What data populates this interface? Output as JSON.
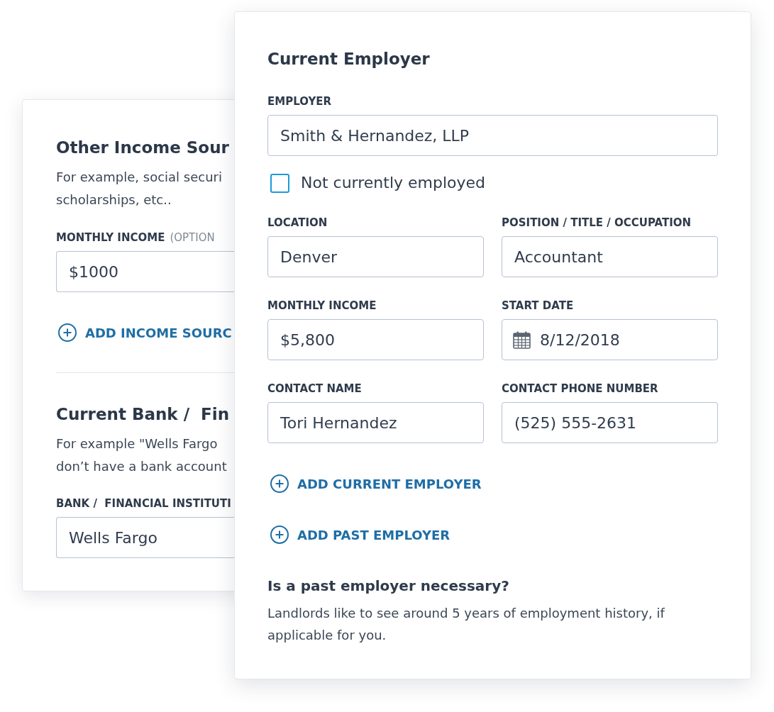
{
  "background_card": {
    "sections": [
      {
        "title": "Other Income Sour",
        "description_lines": [
          "For example, social securi",
          "scholarships, etc.."
        ],
        "field": {
          "label": "MONTHLY INCOME",
          "hint": "(OPTION",
          "value": "$1000"
        },
        "add_link": "ADD INCOME SOURC"
      },
      {
        "title": "Current Bank /  Fin",
        "description_lines": [
          "For example \"Wells Fargo",
          "don’t have a bank account"
        ],
        "field": {
          "label": "BANK /  FINANCIAL INSTITUTI",
          "value": "Wells Fargo"
        }
      }
    ]
  },
  "employer_card": {
    "title": "Current Employer",
    "employer_field": {
      "label": "EMPLOYER",
      "value": "Smith & Hernandez, LLP"
    },
    "not_employed_checkbox": {
      "label": "Not currently employed",
      "checked": false
    },
    "fields": [
      {
        "kind": "text",
        "label": "LOCATION",
        "value": "Denver"
      },
      {
        "kind": "text",
        "label": "POSITION / TITLE / OCCUPATION",
        "value": "Accountant"
      },
      {
        "kind": "text",
        "label": "MONTHLY INCOME",
        "value": "$5,800"
      },
      {
        "kind": "date",
        "label": "START DATE",
        "value": "8/12/2018"
      },
      {
        "kind": "text",
        "label": "CONTACT NAME",
        "value": "Tori Hernandez"
      },
      {
        "kind": "text",
        "label": "CONTACT PHONE NUMBER",
        "value": "(525) 555-2631"
      }
    ],
    "add_links": [
      "ADD CURRENT EMPLOYER",
      "ADD PAST EMPLOYER"
    ],
    "note": {
      "title": "Is a past employer necessary?",
      "lines": [
        "Landlords like to see around 5 years of employment history, if",
        "applicable for you."
      ]
    }
  }
}
